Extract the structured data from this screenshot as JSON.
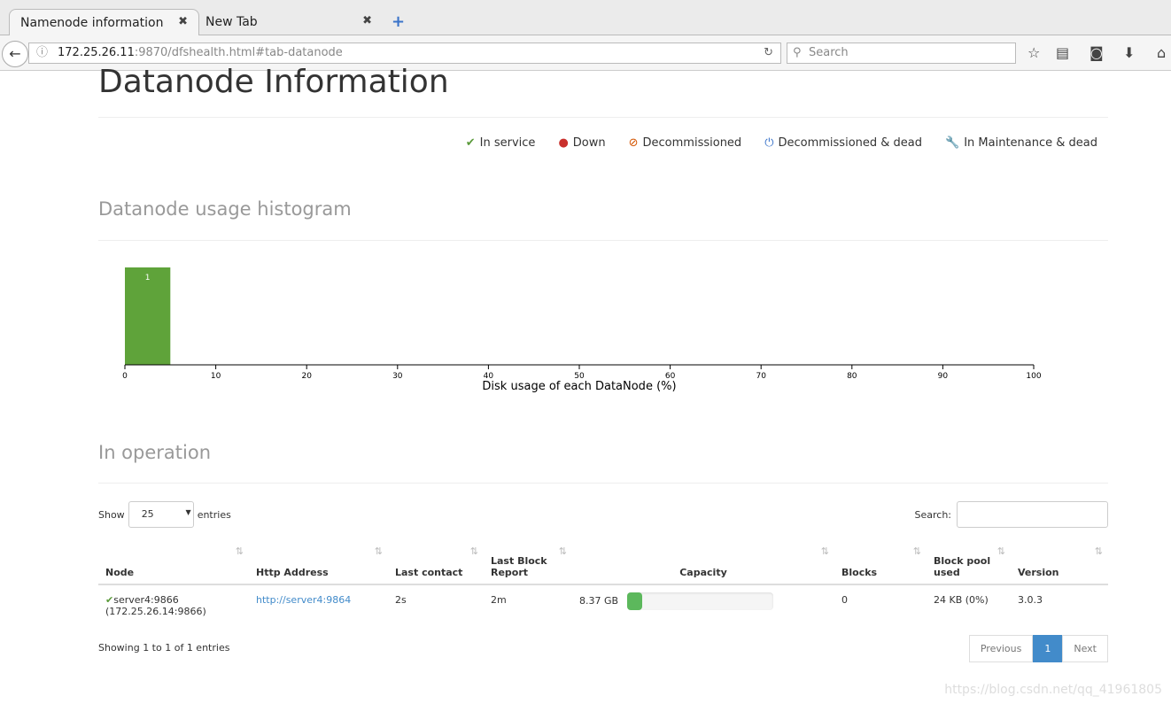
{
  "browser": {
    "tabs": [
      {
        "label": "Namenode information"
      },
      {
        "label": "New Tab"
      }
    ],
    "url_host": "172.25.26.11",
    "url_rest": ":9870/dfshealth.html#tab-datanode",
    "search_placeholder": "Search"
  },
  "page": {
    "title": "Datanode Information",
    "legend": [
      {
        "icon": "✔",
        "label": "In service",
        "color": "#5a9a3a"
      },
      {
        "icon": "●",
        "label": "Down",
        "color": "#c9302c"
      },
      {
        "icon": "⊘",
        "label": "Decommissioned",
        "color": "#d35400"
      },
      {
        "icon": "⏻",
        "label": "Decommissioned & dead",
        "color": "#3a73c9"
      },
      {
        "icon": "🔧",
        "label": "In Maintenance & dead",
        "color": "#f0a030"
      }
    ],
    "histogram_title": "Datanode usage histogram",
    "operation_title": "In operation",
    "show_label": "Show",
    "entries_value": "25",
    "entries_label": "entries",
    "search_label": "Search:",
    "columns": [
      "Node",
      "Http Address",
      "Last contact",
      "Last Block Report",
      "Capacity",
      "Blocks",
      "Block pool used",
      "Version"
    ],
    "rows": [
      {
        "node": "server4:9866",
        "node_ip": "(172.25.26.14:9866)",
        "http": "http://server4:9864",
        "last_contact": "2s",
        "last_block_report": "2m",
        "capacity": "8.37 GB",
        "capacity_used_fraction": 0.1,
        "blocks": "0",
        "block_pool_used": "24 KB (0%)",
        "version": "3.0.3"
      }
    ],
    "info": "Showing 1 to 1 of 1 entries",
    "pager": {
      "previous": "Previous",
      "current": "1",
      "next": "Next"
    },
    "watermark": "https://blog.csdn.net/qq_41961805"
  },
  "chart_data": {
    "type": "bar",
    "xlabel": "Disk usage of each DataNode (%)",
    "xlim": [
      0,
      100
    ],
    "xticks": [
      0,
      10,
      20,
      30,
      40,
      50,
      60,
      70,
      80,
      90,
      100
    ],
    "bins": [
      {
        "x0": 0,
        "x1": 5,
        "count": 1
      }
    ],
    "color": "#5fa33a"
  }
}
